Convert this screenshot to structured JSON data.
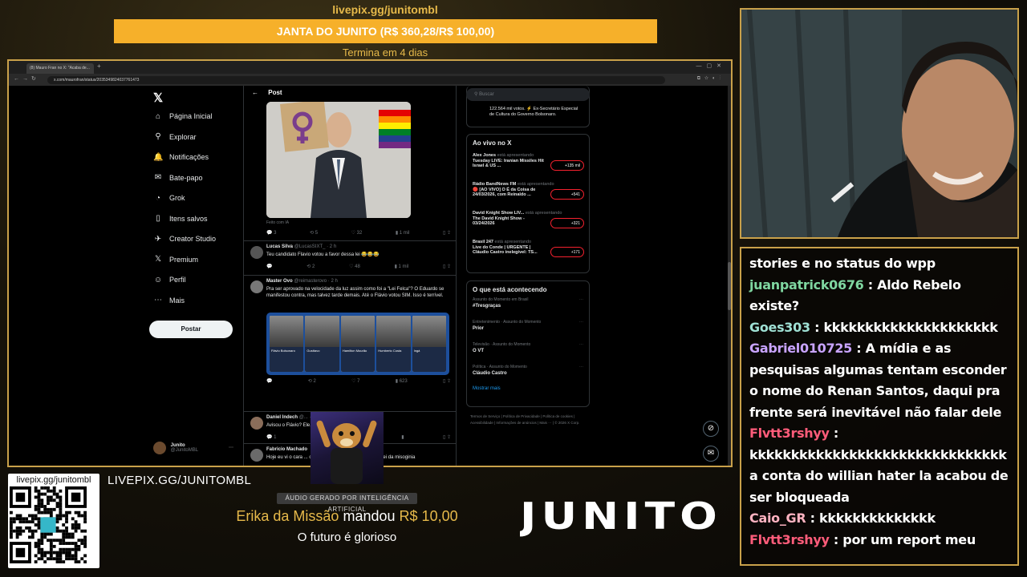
{
  "overlay": {
    "top_link": "livepix.gg/junitombl",
    "goal_label": "JANTA DO JUNITO (R$ 360,28/R$ 100,00)",
    "goal_progress": 1.0,
    "goal_ends": "Termina em 4 dias",
    "bottom_link": "LIVEPIX.GG/JUNITOMBL",
    "qr_label": "livepix.gg/junitombl",
    "ai_badge": "ÁUDIO GERADO POR INTELIGÊNCIA ARTIFICIAL",
    "donation_name": "Erika da Missão",
    "donation_verb": "mandou",
    "donation_amount": "R$ 10,00",
    "donation_message": "O futuro é glorioso",
    "brand": "JUNITO"
  },
  "browser": {
    "tab_title": "(8) Mauro Fran no X: \"Acaba de...",
    "url": "x.com/maurofran/status/2035349824037761473"
  },
  "sidebar": {
    "items": [
      {
        "icon": "home-icon",
        "glyph": "⌂",
        "label": "Página Inicial"
      },
      {
        "icon": "search-icon",
        "glyph": "⚲",
        "label": "Explorar"
      },
      {
        "icon": "bell-icon",
        "glyph": "🔔",
        "label": "Notificações"
      },
      {
        "icon": "envelope-icon",
        "glyph": "✉",
        "label": "Bate-papo"
      },
      {
        "icon": "grok-icon",
        "glyph": "◔",
        "label": "Grok"
      },
      {
        "icon": "bookmark-icon",
        "glyph": "▯",
        "label": "Itens salvos"
      },
      {
        "icon": "bolt-icon",
        "glyph": "✈",
        "label": "Creator Studio"
      },
      {
        "icon": "x-logo-icon",
        "glyph": "𝕏",
        "label": "Premium"
      },
      {
        "icon": "person-icon",
        "glyph": "☺",
        "label": "Perfil"
      },
      {
        "icon": "more-icon",
        "glyph": "⋯",
        "label": "Mais"
      }
    ],
    "post_button": "Postar",
    "profile_name": "Junito",
    "profile_handle": "@JunitoMBL"
  },
  "post": {
    "header": "Post",
    "made_with": "Feito com IA",
    "main_actions": {
      "replies": "3",
      "reposts": "5",
      "likes": "32",
      "views": "1 mil"
    },
    "replies": [
      {
        "name": "Lucas Silva",
        "handle": "@LucasSIXT_ · 2 h",
        "text": "Teu candidato Flavio votou a favor dessa lei 😂😂😂",
        "actions": {
          "replies": "",
          "reposts": "2",
          "likes": "48",
          "views": "1 mil"
        }
      },
      {
        "name": "Master Ovo",
        "handle": "@reimasterovo · 2 h",
        "text": "Pra ser aprovado na velocidade da luz assim como foi a \"Lei Felca\"? O Eduardo se manifestou contra, mas talvez tarde demais. Até o Flávio votou SIM. Isso é terrível.",
        "actions": {
          "replies": "",
          "reposts": "2",
          "likes": "7",
          "views": "623"
        },
        "candidates": [
          "Flávio Bolsonaro",
          "Gusttavo",
          "Hamilton Mourão",
          "Humberto Costa",
          "Ingá"
        ]
      },
      {
        "name": "Daniel Indech",
        "handle": "@... · 2 h",
        "text": "Avisou o Flávio? Ele...",
        "actions": {
          "replies": "1",
          "reposts": "",
          "likes": "",
          "views": ""
        }
      },
      {
        "name": "Fabricio Machado",
        "handle": "",
        "text": "Hoje eu vi o cara ... combater o sistema e a ... votar a lei da misoginia",
        "actions": {
          "replies": "",
          "reposts": "",
          "likes": "",
          "views": ""
        }
      }
    ]
  },
  "right": {
    "search_placeholder": "Buscar",
    "bio_snippet": "122.564 mil votos. ⚡ Ex-Secretário Especial de Cultura do Governo Bolsonaro.",
    "live_title": "Ao vivo no X",
    "live": [
      {
        "host": "Alex Jones",
        "status": "está apresentando",
        "title": "Tuesday LIVE: Iranian Missiles Hit Israel & US ...",
        "count": "+135 mil"
      },
      {
        "host": "Rádio BandNews FM",
        "status": "está apresentando",
        "title": "🔴 [AO VIVO] O É da Coisa de 24/03/2026, com Reinaldo ...",
        "count": "+541"
      },
      {
        "host": "David Knight Show LIV...",
        "status": "está apresentando",
        "title": "The David Knight Show - 03/24/2026",
        "count": "+321"
      },
      {
        "host": "Brasil 247",
        "status": "está apresentando",
        "title": "Live do Conde | URGENTE | Cláudio Castro inelegível: TS...",
        "count": "+171"
      }
    ],
    "trending_title": "O que está acontecendo",
    "trends": [
      {
        "meta": "Assunto do Momento em Brasil",
        "name": "#Tresgraças"
      },
      {
        "meta": "Entretenimento · Assunto do Momento",
        "name": "Prior"
      },
      {
        "meta": "Televisão · Assunto do Momento",
        "name": "O VT"
      },
      {
        "meta": "Política · Assunto do Momento",
        "name": "Cláudio Castro"
      }
    ],
    "show_more": "Mostrar mais",
    "footer": "Termos de Serviço | Política de Privacidade | Política de cookies | Acessibilidade | Informações de anúncios | Mais ··· | © 2026 X Corp."
  },
  "chat": {
    "messages": [
      {
        "user": "",
        "color": "#ffffff",
        "text": "stories e no status do wpp"
      },
      {
        "user": "juanpatrick0676",
        "color": "#7fd6a0",
        "text": ": Aldo Rebelo existe?"
      },
      {
        "user": "Goes303",
        "color": "#9fe0d4",
        "text": ": kkkkkkkkkkkkkkkkkkkkk"
      },
      {
        "user": "Gabriel010725",
        "color": "#c9a4ff",
        "text": ": A mídia e as pesquisas algumas tentam esconder o nome do Renan Santos, daqui pra frente será inevitável não falar dele"
      },
      {
        "user": "Flvtt3rshyy",
        "color": "#ff5c7a",
        "text": ": kkkkkkkkkkkkkkkkkkkkkkkkkkkkkkk a conta do willian hater la acabou de ser bloqueada"
      },
      {
        "user": "Caio_GR",
        "color": "#ffb3c1",
        "text": ": kkkkkkkkkkkkkk"
      },
      {
        "user": "Flvtt3rshyy",
        "color": "#ff5c7a",
        "text": ": por um report meu"
      }
    ]
  }
}
